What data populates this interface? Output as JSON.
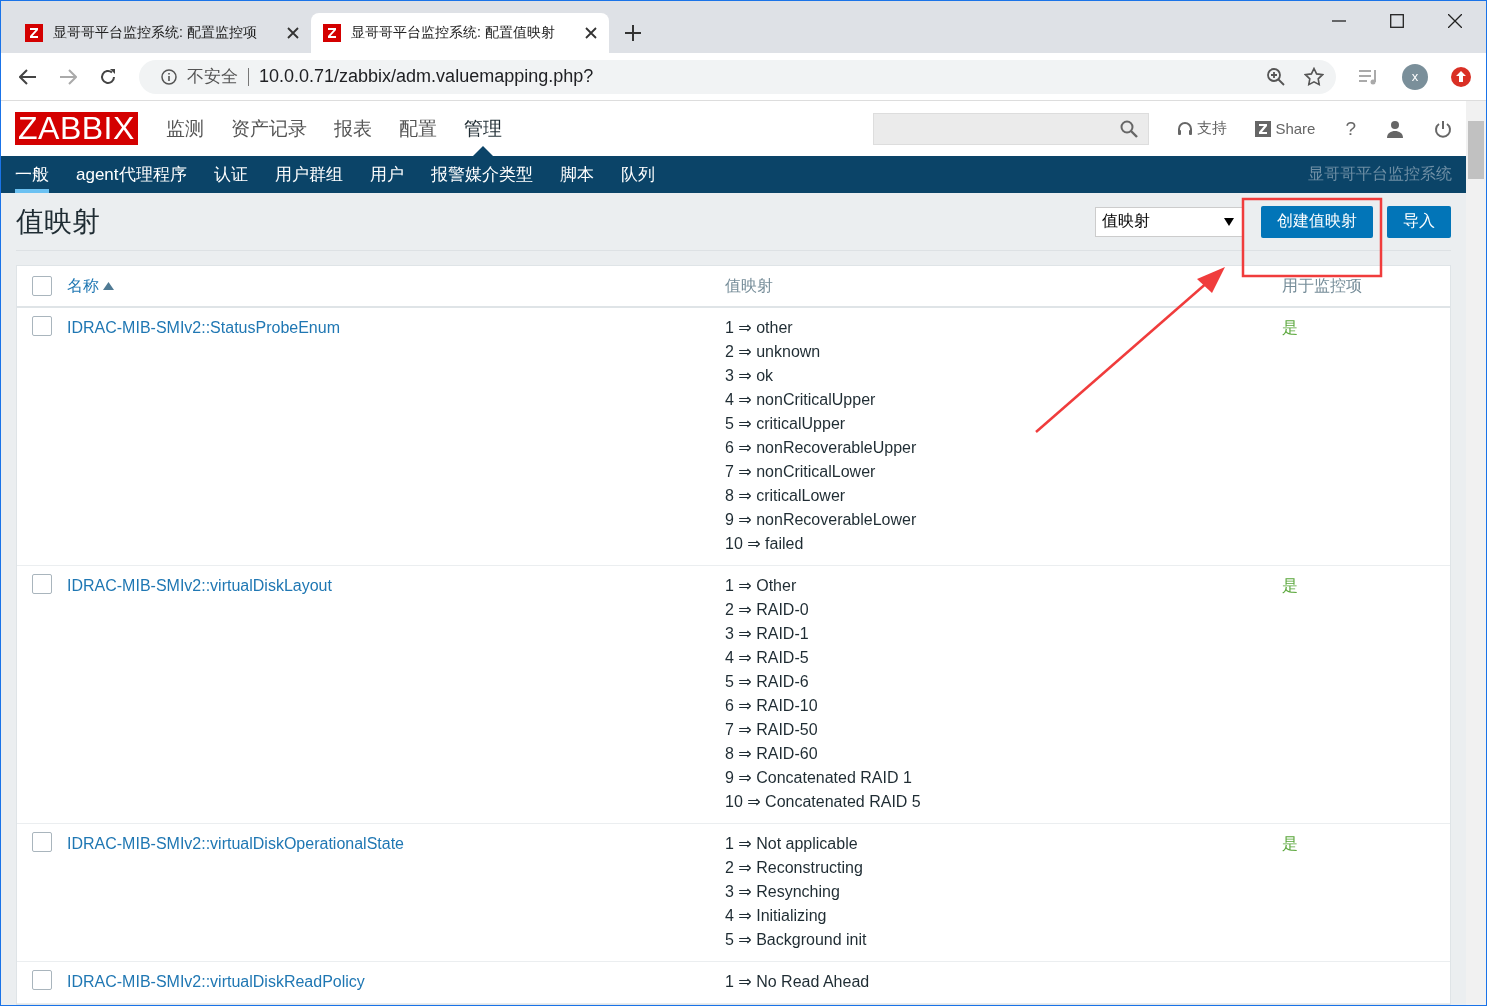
{
  "browser": {
    "tabs": [
      {
        "title": "显哥哥平台监控系统: 配置监控项",
        "selected": false
      },
      {
        "title": "显哥哥平台监控系统: 配置值映射",
        "selected": true
      }
    ],
    "address": {
      "security": "不安全",
      "url": "10.0.0.71/zabbix/adm.valuemapping.php?"
    },
    "profile_initial": "x"
  },
  "header": {
    "logo": "ZABBIX",
    "menu": [
      {
        "label": "监测",
        "selected": false
      },
      {
        "label": "资产记录",
        "selected": false
      },
      {
        "label": "报表",
        "selected": false
      },
      {
        "label": "配置",
        "selected": false
      },
      {
        "label": "管理",
        "selected": true
      }
    ],
    "support": "支持",
    "share": "Share",
    "help": "?"
  },
  "subnav": {
    "items": [
      {
        "label": "一般",
        "selected": true
      },
      {
        "label": "agent代理程序",
        "selected": false
      },
      {
        "label": "认证",
        "selected": false
      },
      {
        "label": "用户群组",
        "selected": false
      },
      {
        "label": "用户",
        "selected": false
      },
      {
        "label": "报警媒介类型",
        "selected": false
      },
      {
        "label": "脚本",
        "selected": false
      },
      {
        "label": "队列",
        "selected": false
      }
    ],
    "brand": "显哥哥平台监控系统"
  },
  "page": {
    "title": "值映射",
    "dropdown": "值映射",
    "buttons": [
      "创建值映射",
      "导入"
    ]
  },
  "table": {
    "select_all_checked": false,
    "columns": [
      {
        "label": "名称",
        "sorted": true
      },
      {
        "label": "值映射",
        "sorted": false
      },
      {
        "label": "用于监控项",
        "sorted": false
      }
    ],
    "rows": [
      {
        "checked": false,
        "name": "IDRAC-MIB-SMIv2::StatusProbeEnum",
        "mappings": [
          "1 ⇒ other",
          "2 ⇒ unknown",
          "3 ⇒ ok",
          "4 ⇒ nonCriticalUpper",
          "5 ⇒ criticalUpper",
          "6 ⇒ nonRecoverableUpper",
          "7 ⇒ nonCriticalLower",
          "8 ⇒ criticalLower",
          "9 ⇒ nonRecoverableLower",
          "10 ⇒ failed"
        ],
        "used": "是"
      },
      {
        "checked": false,
        "name": "IDRAC-MIB-SMIv2::virtualDiskLayout",
        "mappings": [
          "1 ⇒ Other",
          "2 ⇒ RAID-0",
          "3 ⇒ RAID-1",
          "4 ⇒ RAID-5",
          "5 ⇒ RAID-6",
          "6 ⇒ RAID-10",
          "7 ⇒ RAID-50",
          "8 ⇒ RAID-60",
          "9 ⇒ Concatenated RAID 1",
          "10 ⇒ Concatenated RAID 5"
        ],
        "used": "是"
      },
      {
        "checked": false,
        "name": "IDRAC-MIB-SMIv2::virtualDiskOperationalState",
        "mappings": [
          "1 ⇒ Not applicable",
          "2 ⇒ Reconstructing",
          "3 ⇒ Resynching",
          "4 ⇒ Initializing",
          "5 ⇒ Background init"
        ],
        "used": "是"
      },
      {
        "checked": false,
        "name": "IDRAC-MIB-SMIv2::virtualDiskReadPolicy",
        "mappings": [
          "1 ⇒ No Read Ahead"
        ]
      }
    ]
  },
  "annotations": {
    "highlight_box": true,
    "arrow": true
  }
}
